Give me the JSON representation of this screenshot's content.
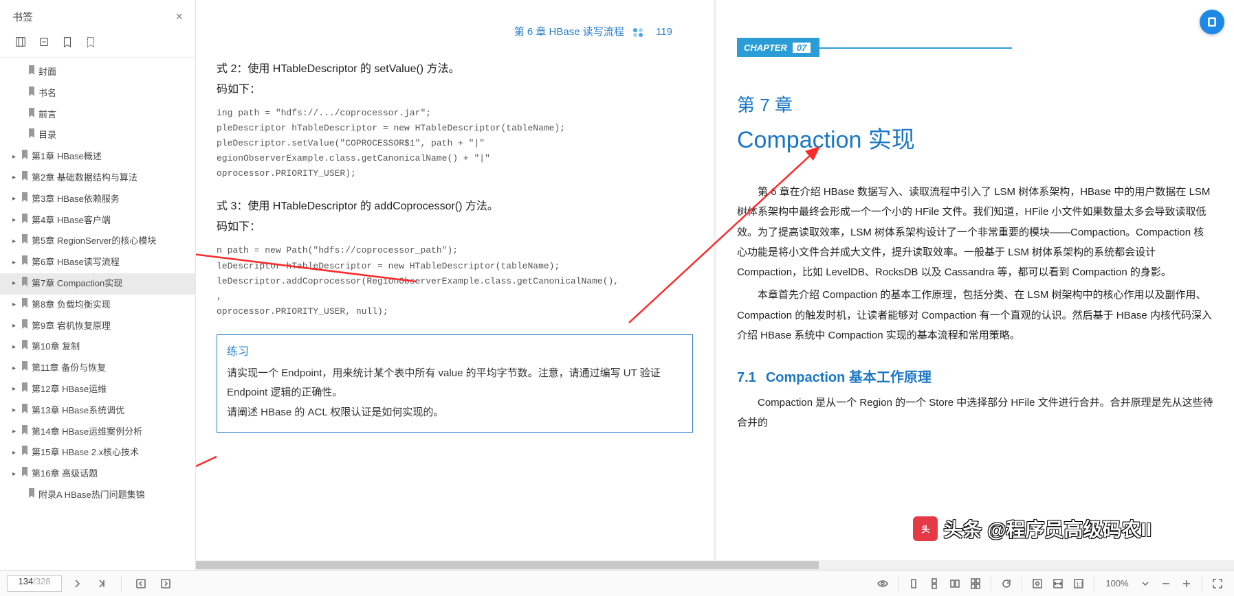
{
  "sidebar": {
    "title": "书签",
    "items": [
      {
        "label": "封面",
        "expandable": false,
        "indent": 1
      },
      {
        "label": "书名",
        "expandable": false,
        "indent": 1
      },
      {
        "label": "前言",
        "expandable": false,
        "indent": 1
      },
      {
        "label": "目录",
        "expandable": false,
        "indent": 1
      },
      {
        "label": "第1章 HBase概述",
        "expandable": true,
        "indent": 0
      },
      {
        "label": "第2章 基础数据结构与算法",
        "expandable": true,
        "indent": 0
      },
      {
        "label": "第3章 HBase依赖服务",
        "expandable": true,
        "indent": 0
      },
      {
        "label": "第4章 HBase客户端",
        "expandable": true,
        "indent": 0
      },
      {
        "label": "第5章 RegionServer的核心模块",
        "expandable": true,
        "indent": 0
      },
      {
        "label": "第6章 HBase读写流程",
        "expandable": true,
        "indent": 0
      },
      {
        "label": "第7章 Compaction实现",
        "expandable": true,
        "indent": 0,
        "selected": true
      },
      {
        "label": "第8章 负载均衡实现",
        "expandable": true,
        "indent": 0
      },
      {
        "label": "第9章 宕机恢复原理",
        "expandable": true,
        "indent": 0
      },
      {
        "label": "第10章 复制",
        "expandable": true,
        "indent": 0
      },
      {
        "label": "第11章 备份与恢复",
        "expandable": true,
        "indent": 0
      },
      {
        "label": "第12章 HBase运维",
        "expandable": true,
        "indent": 0
      },
      {
        "label": "第13章 HBase系统调优",
        "expandable": true,
        "indent": 0
      },
      {
        "label": "第14章 HBase运维案例分析",
        "expandable": true,
        "indent": 0
      },
      {
        "label": "第15章 HBase 2.x核心技术",
        "expandable": true,
        "indent": 0
      },
      {
        "label": "第16章 高级话题",
        "expandable": true,
        "indent": 0
      },
      {
        "label": "附录A   HBase热门问题集锦",
        "expandable": false,
        "indent": 1
      }
    ]
  },
  "left_page": {
    "header": "第 6 章  HBase 读写流程",
    "page_number": "119",
    "way2_title": "式 2：使用 HTableDescriptor 的 setValue() 方法。",
    "way2_ext": "码如下：",
    "code2": "ing path = \"hdfs://.../coprocessor.jar\";\npleDescriptor hTableDescriptor = new HTableDescriptor(tableName);\npleDescriptor.setValue(\"COPROCESSOR$1\", path + \"|\"\negionObserverExample.class.getCanonicalName() + \"|\"\noprocessor.PRIORITY_USER);",
    "way3_title": "式 3：使用 HTableDescriptor 的 addCoprocessor() 方法。",
    "way3_ext": "码如下：",
    "code3": "n path = new Path(\"hdfs://coprocessor_path\");\nleDescriptor hTableDescriptor = new HTableDescriptor(tableName);\nleDescriptor.addCoprocessor(RegionObserverExample.class.getCanonicalName(),\n,\noprocessor.PRIORITY_USER, null);",
    "exercise_title": "练习",
    "exercise_body1": "请实现一个 Endpoint，用来统计某个表中所有 value 的平均字节数。注意，请通过编写 UT 验证 Endpoint 逻辑的正确性。",
    "exercise_body2": "请阐述 HBase 的 ACL 权限认证是如何实现的。"
  },
  "right_page": {
    "chapter_label": "CHAPTER",
    "chapter_num": "07",
    "title_small": "第 7 章",
    "title_big": "Compaction 实现",
    "para1": "第 6 章在介绍 HBase 数据写入、读取流程中引入了 LSM 树体系架构，HBase 中的用户数据在 LSM 树体系架构中最终会形成一个一个小的 HFile 文件。我们知道，HFile 小文件如果数量太多会导致读取低效。为了提高读取效率，LSM 树体系架构设计了一个非常重要的模块——Compaction。Compaction 核心功能是将小文件合并成大文件，提升读取效率。一般基于 LSM 树体系架构的系统都会设计 Compaction，比如 LevelDB、RocksDB 以及 Cassandra 等，都可以看到 Compaction 的身影。",
    "para2": "本章首先介绍 Compaction 的基本工作原理，包括分类、在 LSM 树架构中的核心作用以及副作用、Compaction 的触发时机，让读者能够对 Compaction 有一个直观的认识。然后基于 HBase 内核代码深入介绍 HBase 系统中 Compaction 实现的基本流程和常用策略。",
    "sec_num": "7.1",
    "sec_title": "Compaction 基本工作原理",
    "para3": "Compaction 是从一个 Region 的一个 Store 中选择部分 HFile 文件进行合并。合并原理是先从这些待合并的"
  },
  "footer": {
    "page_current": "134",
    "page_total": "/328",
    "zoom": "100%"
  },
  "watermark": "头条 @程序员高级码农II"
}
